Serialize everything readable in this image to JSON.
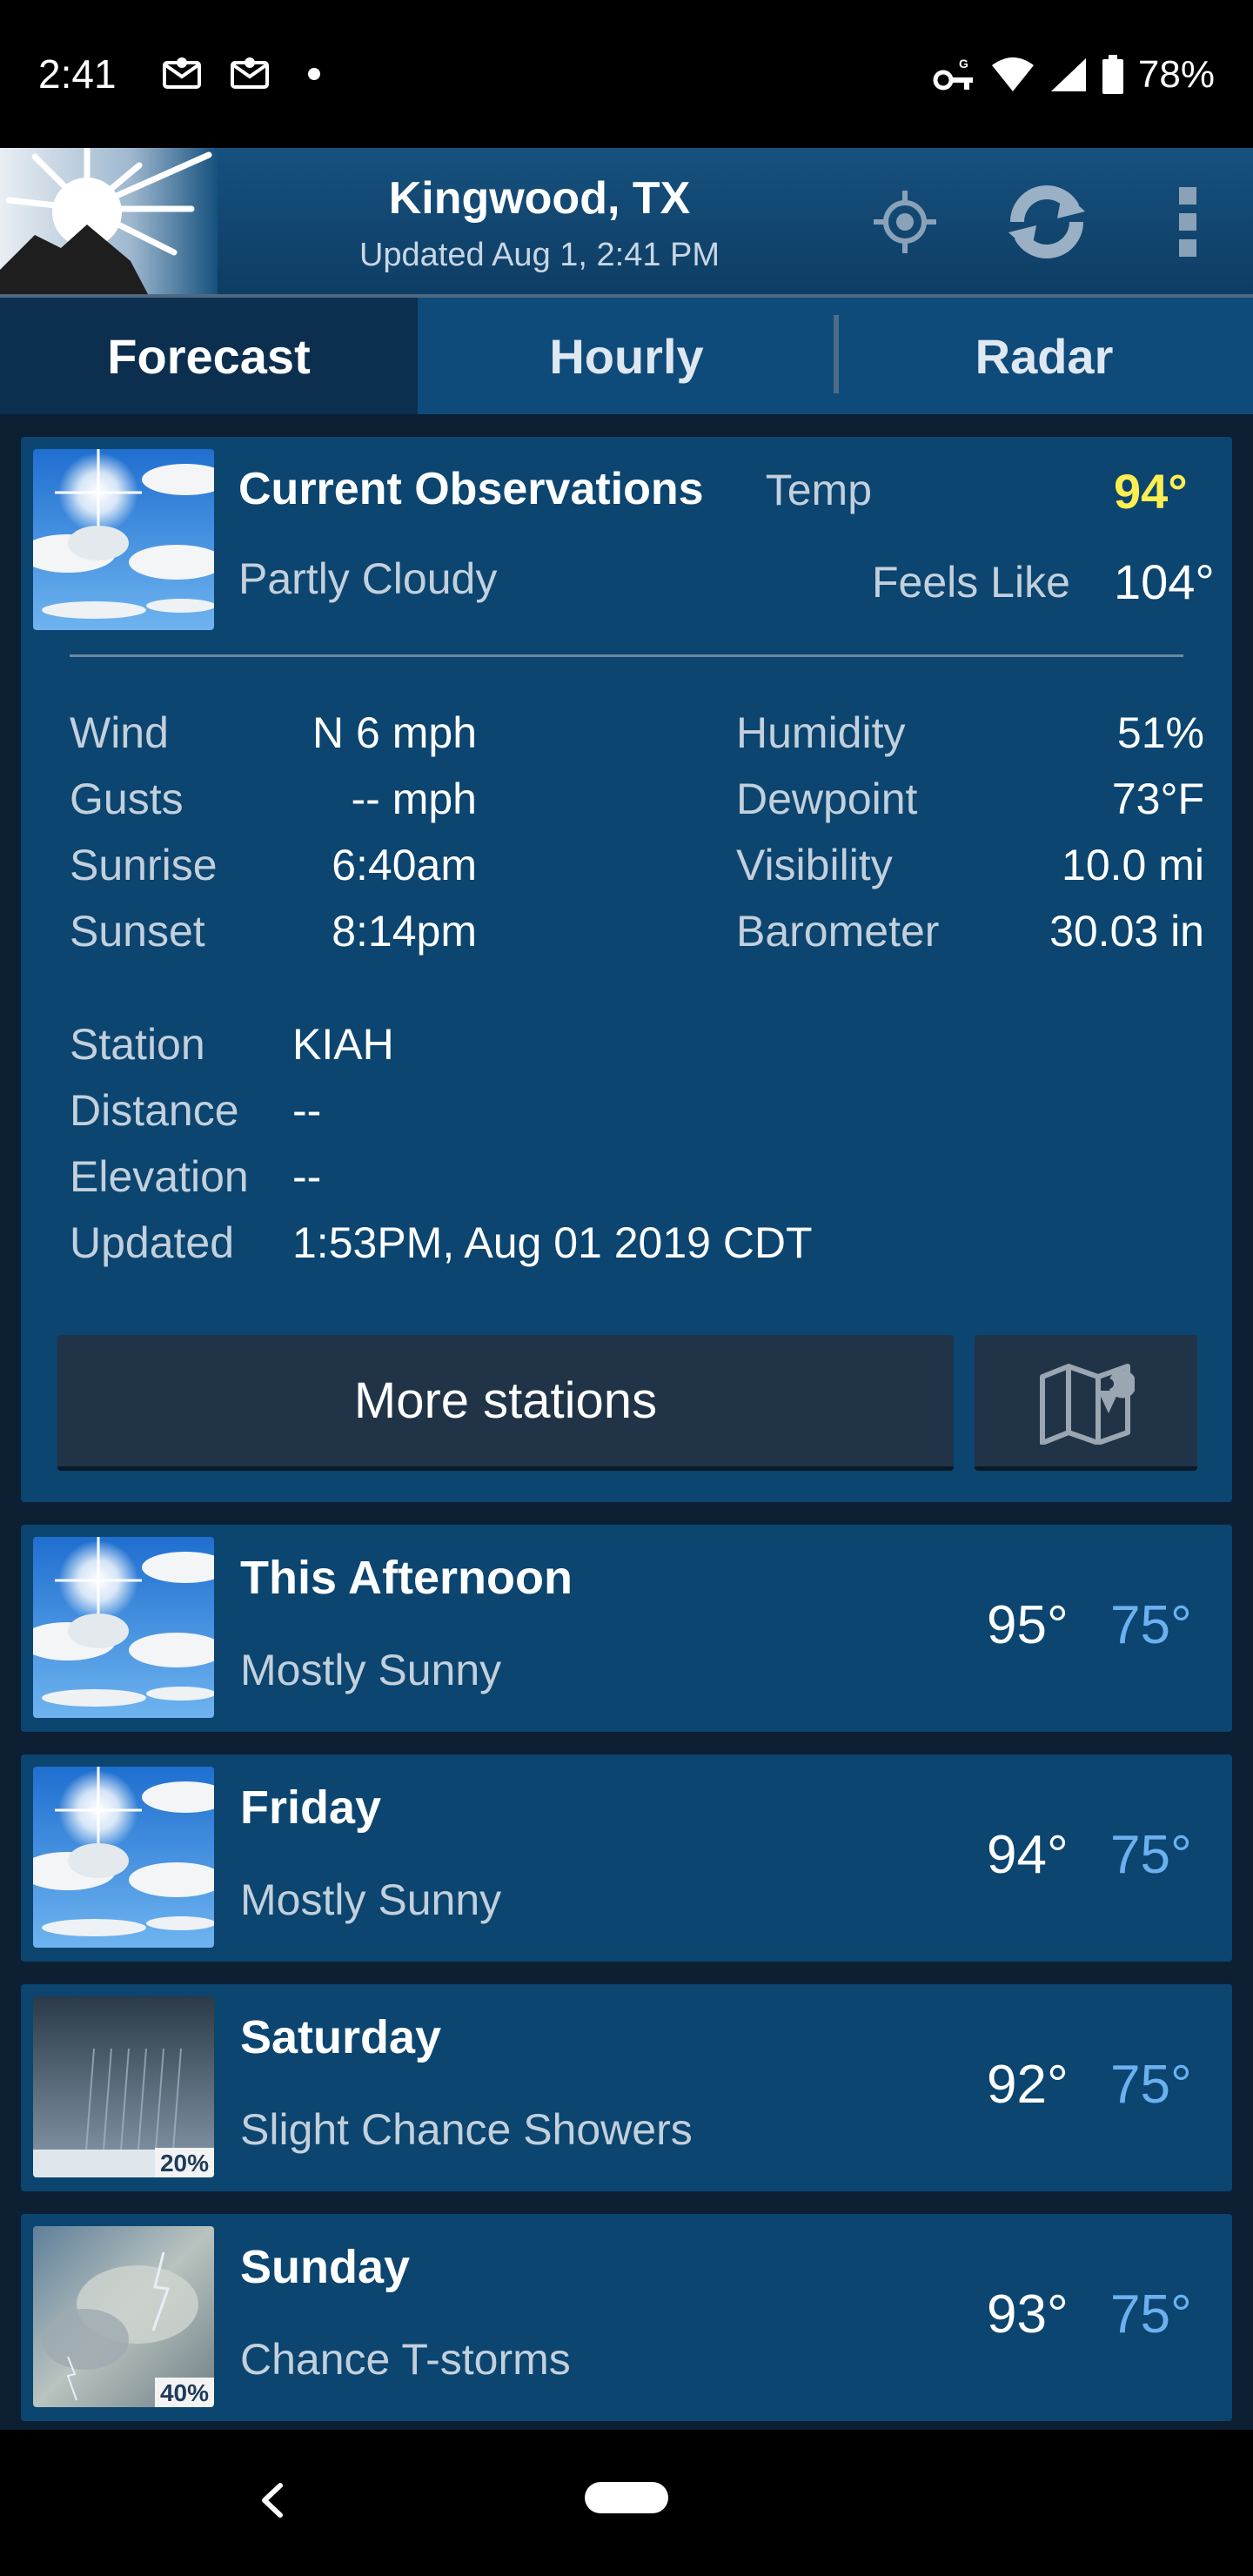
{
  "status_bar": {
    "time": "2:41",
    "battery": "78%",
    "icons": [
      "mail-icon",
      "mail-icon",
      "dot",
      "vpn-key-icon",
      "wifi-icon",
      "signal-icon",
      "battery-icon"
    ]
  },
  "header": {
    "location": "Kingwood, TX",
    "updated": "Updated Aug 1, 2:41 PM",
    "icons": [
      "locate-icon",
      "refresh-icon",
      "overflow-menu-icon"
    ]
  },
  "tabs": [
    {
      "label": "Forecast",
      "active": true
    },
    {
      "label": "Hourly",
      "active": false
    },
    {
      "label": "Radar",
      "active": false
    }
  ],
  "observations": {
    "title": "Current Observations",
    "condition": "Partly Cloudy",
    "temp_label": "Temp",
    "temp_value": "94°",
    "feels_label": "Feels Like",
    "feels_value": "104°",
    "left_rows": [
      {
        "label": "Wind",
        "value": "N 6 mph"
      },
      {
        "label": "Gusts",
        "value": "-- mph"
      },
      {
        "label": "Sunrise",
        "value": "6:40am"
      },
      {
        "label": "Sunset",
        "value": "8:14pm"
      }
    ],
    "right_rows": [
      {
        "label": "Humidity",
        "value": "51%"
      },
      {
        "label": "Dewpoint",
        "value": "73°F"
      },
      {
        "label": "Visibility",
        "value": "10.0 mi"
      },
      {
        "label": "Barometer",
        "value": "30.03 in"
      }
    ],
    "station_rows": [
      {
        "label": "Station",
        "value": "KIAH"
      },
      {
        "label": "Distance",
        "value": "--"
      },
      {
        "label": "Elevation",
        "value": "--"
      },
      {
        "label": "Updated",
        "value": "1:53PM, Aug 01 2019 CDT"
      }
    ],
    "more_button": "More stations"
  },
  "forecast": [
    {
      "day": "This Afternoon",
      "condition": "Mostly Sunny",
      "high": "95°",
      "low": "75°",
      "icon": "partly-cloudy-icon",
      "precip": ""
    },
    {
      "day": "Friday",
      "condition": "Mostly Sunny",
      "high": "94°",
      "low": "75°",
      "icon": "partly-cloudy-icon",
      "precip": ""
    },
    {
      "day": "Saturday",
      "condition": "Slight Chance Showers",
      "high": "92°",
      "low": "75°",
      "icon": "showers-icon",
      "precip": "20%"
    },
    {
      "day": "Sunday",
      "condition": "Chance T-storms",
      "high": "93°",
      "low": "75°",
      "icon": "thunderstorm-icon",
      "precip": "40%"
    }
  ],
  "colors": {
    "card_bg": "#0b4570",
    "tab_active": "#0c2f50",
    "temp_highlight": "#ffee50",
    "low_temp": "#6cb0f0"
  }
}
